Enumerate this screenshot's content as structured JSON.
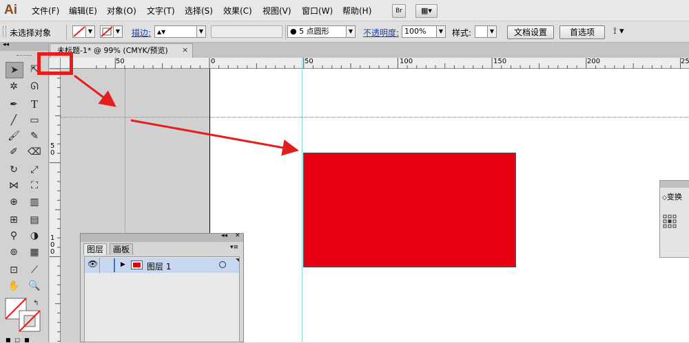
{
  "app": {
    "logo": "Ai",
    "menus": [
      "文件(F)",
      "编辑(E)",
      "对象(O)",
      "文字(T)",
      "选择(S)",
      "效果(C)",
      "视图(V)",
      "窗口(W)",
      "帮助(H)"
    ],
    "bridge_label": "Br"
  },
  "control_bar": {
    "selection_status": "未选择对象",
    "stroke_label": "描边:",
    "brush_value": "5 点圆形",
    "opacity_label": "不透明度:",
    "opacity_value": "100%",
    "style_label": "样式:",
    "doc_setup_button": "文档设置",
    "preferences_button": "首选项"
  },
  "document": {
    "tab_title": "未标题-1* @ 99% (CMYK/预览)",
    "tab_close": "×"
  },
  "rulers": {
    "horizontal_labels": [
      "50",
      "0",
      "50",
      "100",
      "150",
      "200",
      "25"
    ],
    "vertical_labels": [
      "5\n0",
      "1\n0\n0"
    ]
  },
  "layers_panel": {
    "tabs": [
      "图层",
      "画板"
    ],
    "layer_name": "图层 1",
    "layer_color": "#e60012"
  },
  "transform_panel": {
    "title": "变换"
  },
  "colors": {
    "rect_fill": "#e60012",
    "guide": "#7fd6e6",
    "annotation": "#e41e1e"
  }
}
